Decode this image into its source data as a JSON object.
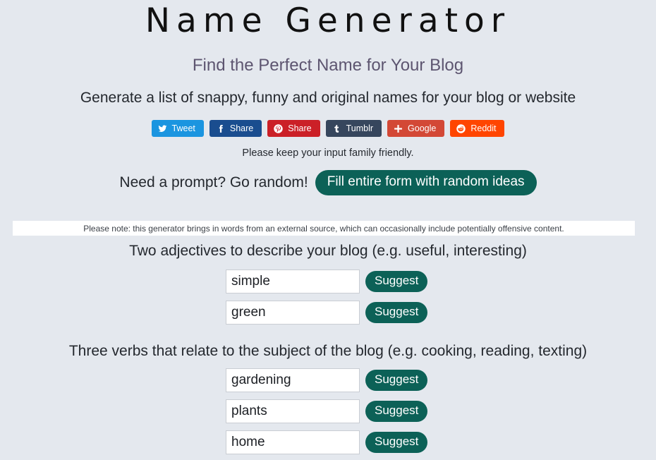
{
  "header": {
    "title": "Name Generator",
    "subtitle": "Find the Perfect Name for Your Blog",
    "tagline": "Generate a list of snappy, funny and original names for your blog or website",
    "family_note": "Please keep your input family friendly."
  },
  "social": {
    "buttons": [
      {
        "label": "Tweet",
        "icon": "twitter-icon",
        "color": "#1b95e0"
      },
      {
        "label": "Share",
        "icon": "facebook-icon",
        "color": "#1a4d8f"
      },
      {
        "label": "Share",
        "icon": "pinterest-icon",
        "color": "#cb2027"
      },
      {
        "label": "Tumblr",
        "icon": "tumblr-icon",
        "color": "#36465d"
      },
      {
        "label": "Google",
        "icon": "google-plus-icon",
        "color": "#d34836"
      },
      {
        "label": "Reddit",
        "icon": "reddit-icon",
        "color": "#ff4500"
      }
    ]
  },
  "random_prompt": {
    "label": "Need a prompt? Go random!",
    "button_label": "Fill entire form with random ideas"
  },
  "notice": {
    "text": "Please note: this generator brings in words from an external source, which can occasionally include potentially offensive content."
  },
  "form": {
    "suggest_label": "Suggest",
    "groups": [
      {
        "label": "Two adjectives to describe your blog (e.g. useful, interesting)",
        "fields": [
          {
            "value": "simple",
            "placeholder": ""
          },
          {
            "value": "green",
            "placeholder": ""
          }
        ]
      },
      {
        "label": "Three verbs that relate to the subject of the blog (e.g. cooking, reading, texting)",
        "fields": [
          {
            "value": "gardening",
            "placeholder": ""
          },
          {
            "value": "plants",
            "placeholder": ""
          },
          {
            "value": "home",
            "placeholder": ""
          }
        ]
      }
    ]
  },
  "theme": {
    "background": "#e4e8ee",
    "accent_teal": "#0c6157",
    "subtitle_color": "#5d5570",
    "text_color": "#24282e"
  }
}
